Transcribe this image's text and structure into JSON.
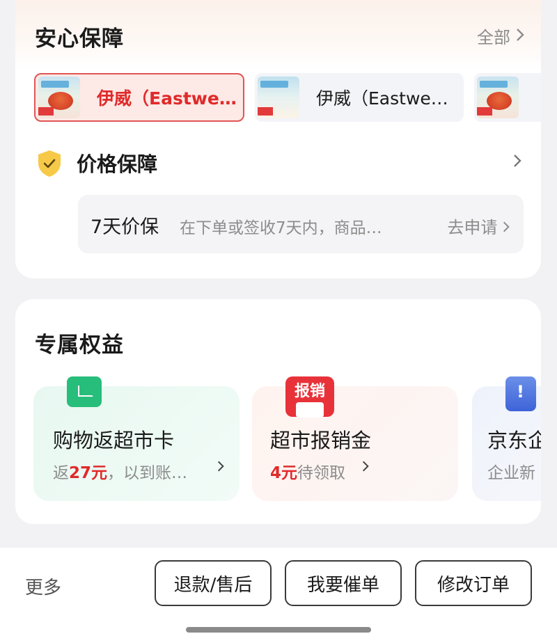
{
  "guarantee": {
    "title": "安心保障",
    "all_label": "全部",
    "products": [
      {
        "name": "伊威（Eastwe…",
        "selected": true
      },
      {
        "name": "伊威（Eastwe…",
        "selected": false
      },
      {
        "name": "",
        "selected": false
      }
    ],
    "price_protection": {
      "title": "价格保障",
      "label": "7天价保",
      "description": "在下单或签收7天内，商品…",
      "action": "去申请"
    }
  },
  "benefits": {
    "title": "专属权益",
    "items": [
      {
        "title": "购物返超市卡",
        "sub_prefix": "返",
        "sub_highlight": "27元",
        "sub_suffix": "，以到账…",
        "icon": "supermarket-card-icon",
        "icon_color": "#27bd7a"
      },
      {
        "title": "超市报销金",
        "sub_prefix": "",
        "sub_highlight": "4元",
        "sub_suffix": "待领取",
        "icon": "baoxiao-icon",
        "icon_text": "报销",
        "icon_color": "#e8323a"
      },
      {
        "title": "京东企",
        "sub_prefix": "",
        "sub_highlight": "",
        "sub_suffix": "企业新",
        "icon": "enterprise-phone-icon",
        "icon_color": "#3e63d8"
      }
    ]
  },
  "bottom_bar": {
    "more": "更多",
    "buttons": [
      "退款/售后",
      "我要催单",
      "修改订单"
    ]
  },
  "colors": {
    "accent_red": "#e02a2a",
    "text_secondary": "#8c8c8c",
    "background": "#f2f2f4"
  }
}
